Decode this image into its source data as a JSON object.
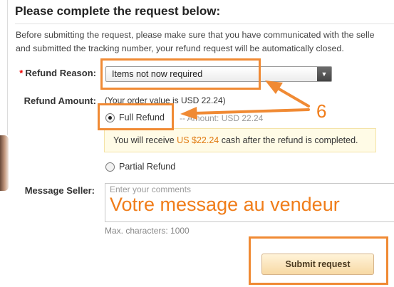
{
  "title": "Please complete the request below:",
  "intro": {
    "line1": "Before submitting the request, please make sure that you have communicated with the selle",
    "line2": "and submitted the tracking number, your refund request will be automatically closed."
  },
  "refund_reason": {
    "required_mark": "*",
    "label": "Refund Reason:",
    "selected": "Items not now required"
  },
  "refund_amount": {
    "label": "Refund Amount:",
    "order_value": "(Your order value is USD 22.24)",
    "full_refund_label": "Full Refund",
    "amount_note": "-- Amount: USD 22.24",
    "notice_before": "You will receive ",
    "notice_amount": "US $22.24",
    "notice_after": " cash after the refund is completed.",
    "partial_refund_label": "Partial Refund"
  },
  "message": {
    "label": "Message Seller:",
    "placeholder": "Enter your comments",
    "annotation": "Votre message au vendeur",
    "max_chars": "Max. characters: 1000"
  },
  "submit_label": "Submit request",
  "annotation_step": "6",
  "colors": {
    "annotation_orange": "#f08a34",
    "price_orange": "#e07a10"
  }
}
